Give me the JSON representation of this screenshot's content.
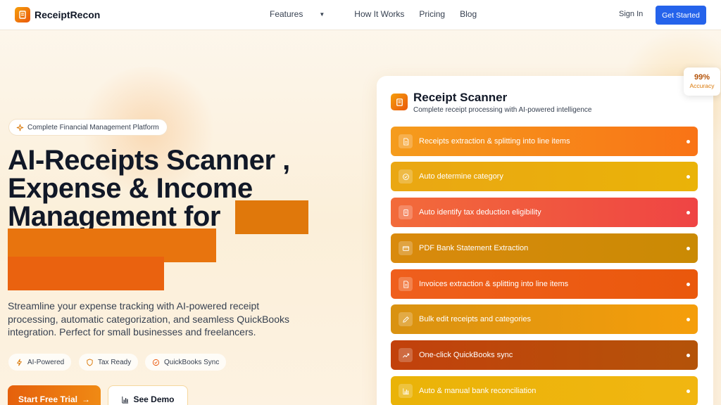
{
  "brand": {
    "name": "ReceiptRecon",
    "logo_icon": "receipt-icon"
  },
  "nav": {
    "links": [
      {
        "label": "Features",
        "has_dropdown": true
      },
      {
        "label": "How It Works"
      },
      {
        "label": "Pricing"
      },
      {
        "label": "Blog"
      }
    ],
    "signin_label": "Sign In",
    "cta_label": "Get Started"
  },
  "hero": {
    "pill_label": "Complete Financial Management Platform",
    "headline_lines": [
      "AI-Receipts Scanner ,",
      "Expense & Income",
      "Management for"
    ],
    "subtitle": "Streamline your expense tracking with AI-powered receipt processing, automatic categorization, and seamless QuickBooks integration. Perfect for small businesses and freelancers.",
    "features": [
      {
        "label": "AI-Powered",
        "icon": "bolt-icon"
      },
      {
        "label": "Tax Ready",
        "icon": "shield-icon"
      },
      {
        "label": "QuickBooks Sync",
        "icon": "check-circle-icon"
      }
    ],
    "primary_cta": "Start Free Trial",
    "secondary_cta": "See Demo"
  },
  "scanner": {
    "title": "Receipt Scanner",
    "subtitle": "Complete receipt processing with AI-powered intelligence",
    "accuracy_value": "99%",
    "accuracy_label": "Accuracy",
    "items": [
      {
        "label": "Receipts extraction & splitting into line items",
        "icon": "document-icon"
      },
      {
        "label": "Auto determine category",
        "icon": "check-circle-icon"
      },
      {
        "label": "Auto identify tax deduction eligibility",
        "icon": "receipt-icon"
      },
      {
        "label": "PDF Bank Statement Extraction",
        "icon": "card-icon"
      },
      {
        "label": "Invoices extraction & splitting into line items",
        "icon": "document-icon"
      },
      {
        "label": "Bulk edit receipts and categories",
        "icon": "pencil-icon"
      },
      {
        "label": "One-click QuickBooks sync",
        "icon": "trend-up-icon"
      },
      {
        "label": "Auto & manual bank reconciliation",
        "icon": "bar-chart-icon"
      }
    ]
  },
  "colors": {
    "accent_blue": "#2563eb",
    "accent_orange": "#ea580c",
    "brand_amber": "#f59e0b"
  }
}
